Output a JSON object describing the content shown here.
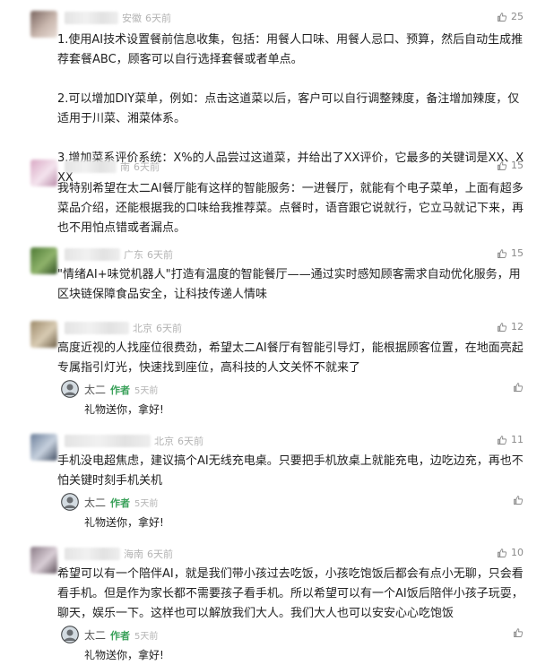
{
  "author_tag": "作者",
  "comments": [
    {
      "location": "安徽",
      "time": "6天前",
      "likes": "25",
      "avatar_colors": [
        "#7a6660",
        "#c9b7ae",
        "#e9ddd6"
      ],
      "paragraphs": [
        "1.使用AI技术设置餐前信息收集，包括：用餐人口味、用餐人忌口、预算，然后自动生成推荐套餐ABC，顾客可以自行选择套餐或者单点。",
        "2.可以增加DIY菜单，例如：点击这道菜以后，客户可以自行调整辣度，备注增加辣度，仅适用于川菜、湘菜体系。",
        "3.增加菜系评价系统：X%的人品尝过这道菜，并给出了XX评价，它最多的关键词是XX、XXX"
      ]
    },
    {
      "location": "南",
      "time": "6天前",
      "likes": "15",
      "avatar_colors": [
        "#d9a8c4",
        "#f4e4ee",
        "#b98aa8"
      ],
      "paragraphs": [
        "我特别希望在太二AI餐厅能有这样的智能服务：一进餐厅，就能有个电子菜单，上面有超多菜品介绍，还能根据我的口味给我推荐菜。点餐时，语音跟它说就行，它立马就记下来，再也不用怕点错或者漏点。"
      ]
    },
    {
      "location": "广东",
      "time": "6天前",
      "likes": "15",
      "avatar_colors": [
        "#4e7a35",
        "#8fb36b",
        "#2f4f22"
      ],
      "paragraphs": [
        "\"情绪AI+味觉机器人\"打造有温度的智能餐厅——通过实时感知顾客需求自动优化服务，用区块链保障食品安全，让科技传递人情味"
      ]
    },
    {
      "location": "北京",
      "time": "6天前",
      "likes": "12",
      "avatar_colors": [
        "#9d8a6a",
        "#d8cbb3",
        "#6e5f47"
      ],
      "paragraphs": [
        "高度近视的人找座位很费劲，希望太二AI餐厅有智能引导灯，能根据顾客位置，在地面亮起专属指引灯光，快速找到座位，高科技的人文关怀不就来了"
      ],
      "reply": {
        "name": "太二",
        "time": "5天前",
        "text": "礼物送你，拿好!"
      }
    },
    {
      "location": "北京",
      "time": "6天前",
      "likes": "11",
      "avatar_colors": [
        "#6c7f9a",
        "#c7d1de",
        "#3f4c61"
      ],
      "paragraphs": [
        "手机没电超焦虑，建议搞个AI无线充电桌。只要把手机放桌上就能充电，边吃边充，再也不怕关键时刻手机关机"
      ],
      "reply": {
        "name": "太二",
        "time": "5天前",
        "text": "礼物送你，拿好!"
      }
    },
    {
      "location": "海南",
      "time": "6天前",
      "likes": "10",
      "avatar_colors": [
        "#8a7b86",
        "#d9ced6",
        "#5c4f59"
      ],
      "paragraphs": [
        "希望可以有一个陪伴AI，就是我们带小孩过去吃饭，小孩吃饱饭后都会有点小无聊，只会看看手机。但是作为家长都不需要孩子看手机。所以希望可以有一个AI饭后陪伴小孩子玩耍，聊天，娱乐一下。这样也可以解放我们大人。我们大人也可以安安心心吃饱饭"
      ],
      "reply": {
        "name": "太二",
        "time": "5天前",
        "text": "礼物送你，拿好!"
      }
    }
  ]
}
